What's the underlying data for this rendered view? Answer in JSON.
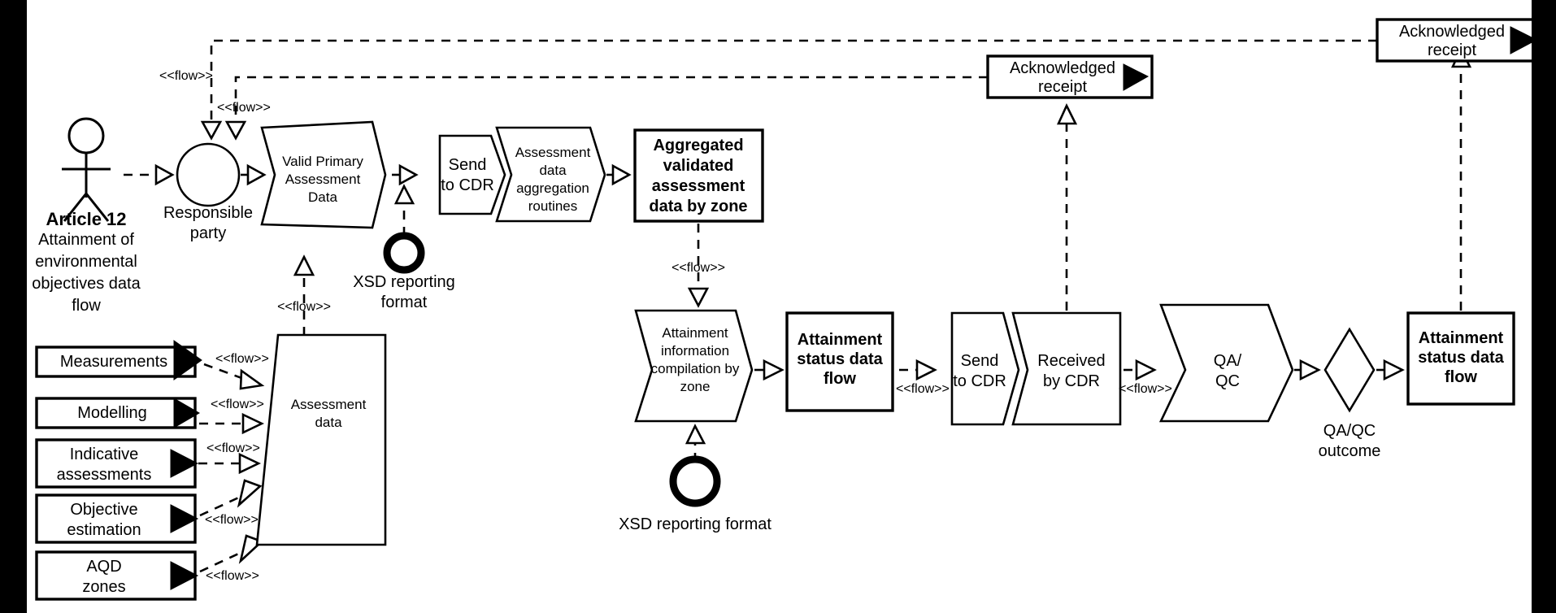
{
  "diagram": {
    "title": "Article 12 Attainment of environmental objectives data flow",
    "actor": {
      "name_bold": "Article 12",
      "description": "Attainment of\nenvironmental\nobjectives data\nflow",
      "desc_lines": [
        "Attainment of",
        "environmental",
        "objectives data",
        "flow"
      ]
    },
    "flow_stereotype": "<<flow>>",
    "nodes": {
      "responsible_party": {
        "label_lines": [
          "Responsible",
          "party"
        ],
        "shape": "circle"
      },
      "valid_primary": {
        "label_lines": [
          "Valid Primary",
          "Assessment",
          "Data"
        ],
        "shape": "process-chevron"
      },
      "send_to_cdr_top": {
        "label_lines": [
          "Send",
          "to CDR"
        ],
        "shape": "chevron-notch"
      },
      "aggregation_routines": {
        "label_lines": [
          "Assessment",
          "data",
          "aggregation",
          "routines"
        ],
        "shape": "process-chevron"
      },
      "aggregated_validated": {
        "label_lines": [
          "Aggregated",
          "validated",
          "assessment",
          "data by zone"
        ],
        "shape": "rect",
        "bold": true
      },
      "xsd_top": {
        "label_lines": [
          "XSD reporting",
          "format"
        ],
        "shape": "ring"
      },
      "assessment_data_store": {
        "label_lines": [
          "Assessment",
          "data"
        ],
        "shape": "skew-parallelogram"
      },
      "xsd_bottom": {
        "label_lines": [
          "XSD reporting format"
        ],
        "shape": "ring"
      },
      "attainment_compilation": {
        "label_lines": [
          "Attainment",
          "information",
          "compilation by",
          "zone"
        ],
        "shape": "process-chevron"
      },
      "attainment_status_mid": {
        "label_lines": [
          "Attainment",
          "status data",
          "flow"
        ],
        "shape": "rect",
        "bold": true
      },
      "send_to_cdr_bottom": {
        "label_lines": [
          "Send",
          "to CDR"
        ],
        "shape": "chevron-notch"
      },
      "received_by_cdr": {
        "label_lines": [
          "Received",
          "by CDR"
        ],
        "shape": "chevron-notch"
      },
      "qa_qc": {
        "label_lines": [
          "QA/",
          "QC"
        ],
        "shape": "process-chevron"
      },
      "qa_qc_outcome": {
        "label_lines": [
          "QA/QC",
          "outcome"
        ],
        "shape": "diamond"
      },
      "attainment_status_right": {
        "label_lines": [
          "Attainment",
          "status data",
          "flow"
        ],
        "shape": "rect",
        "bold": true
      },
      "ack_receipt_mid": {
        "label_lines": [
          "Acknowledged",
          "receipt"
        ],
        "shape": "rect-play"
      },
      "ack_receipt_right": {
        "label_lines": [
          "Acknowledged",
          "receipt"
        ],
        "shape": "rect-play"
      }
    },
    "sources": [
      {
        "label_lines": [
          "Measurements"
        ],
        "flow": "<<flow>>"
      },
      {
        "label_lines": [
          "Modelling"
        ],
        "flow": "<<flow>>"
      },
      {
        "label_lines": [
          "Indicative",
          "assessments"
        ],
        "flow": "<<flow>>"
      },
      {
        "label_lines": [
          "Objective",
          "estimation"
        ],
        "flow": "<<flow>>"
      },
      {
        "label_lines": [
          "AQD",
          "zones"
        ],
        "flow": "<<flow>>"
      }
    ],
    "flow_labels": {
      "top_left_1": "<<flow>>",
      "top_left_2": "<<flow>>",
      "xsd_to_valid": "<<flow>>",
      "aggregated_down": "<<flow>>",
      "status_to_send": "<<flow>>",
      "received_to_qa": "<<flow>>"
    },
    "colors": {
      "stroke": "#000000",
      "fill": "#ffffff",
      "edge_bar": "#000000"
    }
  }
}
